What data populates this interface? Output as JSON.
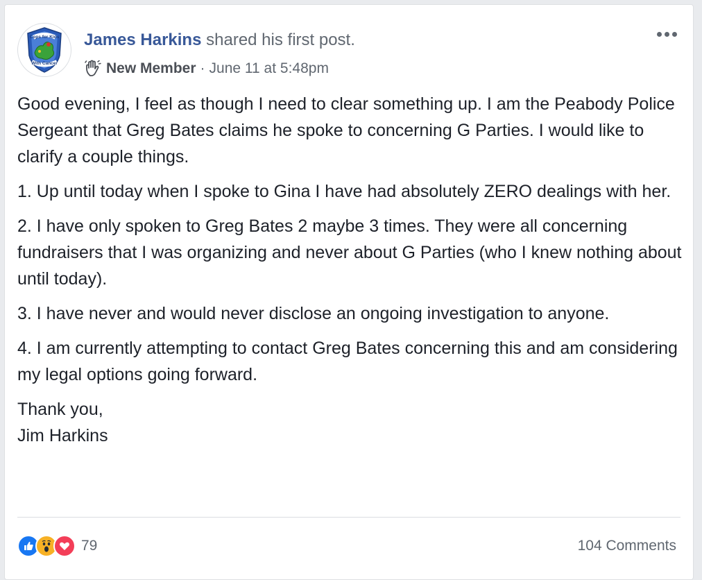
{
  "post": {
    "author_name": "James Harkins",
    "author_action": "shared his first post.",
    "badge_icon": "waving-hand-icon",
    "badge_label": "New Member",
    "separator": "·",
    "timestamp": "June 11 at 5:48pm",
    "avatar": {
      "icon": "cops-for-kids-with-cancer-logo",
      "text_top": "Cops for Kids",
      "text_bottom": "With Cancer"
    },
    "paragraphs": [
      "Good evening, I feel as though I need to clear something up. I am the Peabody Police Sergeant that Greg Bates claims he spoke to concerning G Parties. I would like to clarify a couple things.",
      "1. Up until today when I spoke to Gina I have had absolutely ZERO dealings with her.",
      "2. I have only spoken to Greg Bates 2 maybe 3 times. They were all concerning fundraisers that I was organizing and never about G Parties (who I knew nothing about until today).",
      "3. I have never and would never disclose an ongoing investigation to anyone.",
      "4. I am currently attempting to contact Greg Bates concerning this and am considering my legal options going forward."
    ],
    "signoff_1": "Thank you,",
    "signoff_2": "Jim Harkins"
  },
  "footer": {
    "reactions": [
      "like-icon",
      "wow-icon",
      "love-icon"
    ],
    "reaction_count": "79",
    "comments_label": "104 Comments"
  },
  "colors": {
    "link_blue": "#385898",
    "like_blue": "#1877f2",
    "wow_yellow": "#f7b125",
    "love_red": "#f33e58",
    "meta_gray": "#606770"
  }
}
